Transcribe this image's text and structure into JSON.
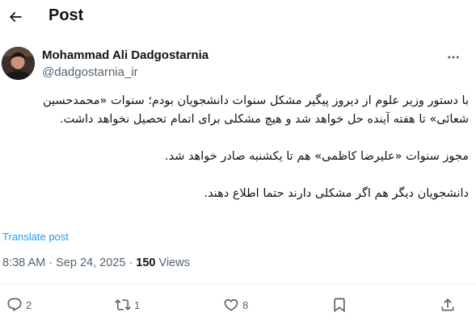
{
  "header": {
    "title": "Post",
    "back_icon": "arrow-left-icon"
  },
  "author": {
    "name": "Mohammad Ali Dadgostarnia",
    "handle": "@dadgostarnia_ir",
    "avatar_icon": "avatar-photo"
  },
  "post": {
    "paragraphs": [
      "با دستور وزیر علوم از دیروز پیگیر مشکل سنوات دانشجویان بودم؛ سنوات «محمدحسین شعائی» تا هفته آینده حل خواهد شد و هیچ مشکلی برای اتمام تحصیل نخواهد داشت.",
      "مجوز سنوات «علیرضا کاظمی» هم تا یکشنبه صادر خواهد شد.",
      "دانشجویان دیگر هم اگر مشکلی دارند حتما اطلاع دهند."
    ],
    "translate_label": "Translate post",
    "time": "8:38 AM",
    "separator": "·",
    "date": "Sep 24, 2025",
    "views_count": "150",
    "views_label": "Views"
  },
  "actions": {
    "replies": "2",
    "reposts": "1",
    "likes": "8"
  },
  "colors": {
    "text": "#0f1419",
    "secondary": "#536471",
    "link": "#1d9bf0",
    "divider": "#eff3f4"
  }
}
